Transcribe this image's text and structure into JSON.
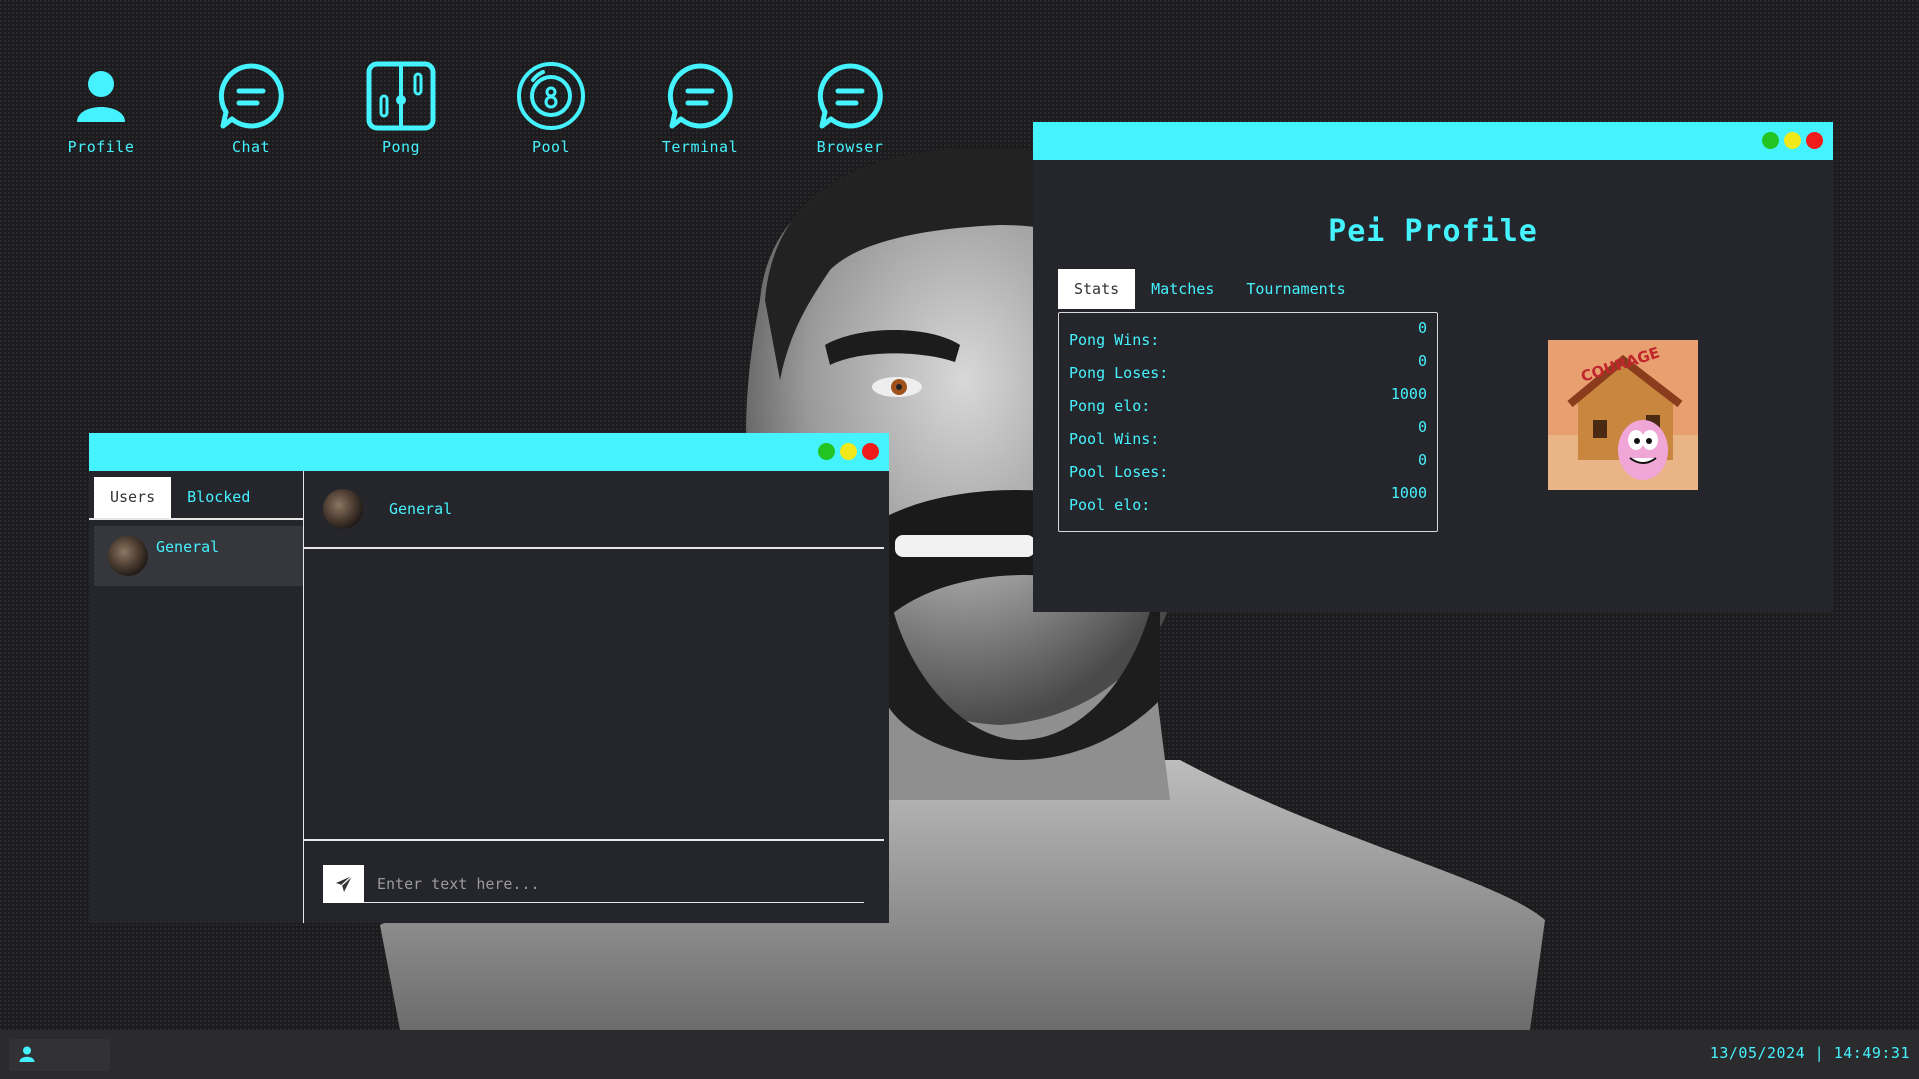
{
  "desktop": {
    "icons": [
      {
        "label": "Profile",
        "icon": "user-icon"
      },
      {
        "label": "Chat",
        "icon": "chat-bubble-icon"
      },
      {
        "label": "Pong",
        "icon": "pong-icon"
      },
      {
        "label": "Pool",
        "icon": "eight-ball-icon"
      },
      {
        "label": "Terminal",
        "icon": "chat-bubble-icon"
      },
      {
        "label": "Browser",
        "icon": "chat-bubble-icon"
      }
    ]
  },
  "chat_window": {
    "tabs": [
      "Users",
      "Blocked"
    ],
    "users": [
      {
        "name": "General"
      }
    ],
    "active_chat": "General",
    "input_placeholder": "Enter text here..."
  },
  "profile_window": {
    "title": "Pei Profile",
    "tabs": [
      "Stats",
      "Matches",
      "Tournaments"
    ],
    "stats": [
      {
        "label": "Pong Wins:",
        "value": "0"
      },
      {
        "label": "Pong Loses:",
        "value": "0"
      },
      {
        "label": "Pong elo:",
        "value": "1000"
      },
      {
        "label": "Pool Wins:",
        "value": "0"
      },
      {
        "label": "Pool Loses:",
        "value": "0"
      },
      {
        "label": "Pool elo:",
        "value": "1000"
      }
    ],
    "picture_caption": "COURAGE THE COWARDLY DOG"
  },
  "taskbar": {
    "clock": "13/05/2024 | 14:49:31"
  },
  "colors": {
    "accent": "#45f3ff",
    "window_bg": "#25262b",
    "close": "#ef1a1a",
    "minimize": "#f2e91a",
    "maximize": "#22c422"
  }
}
